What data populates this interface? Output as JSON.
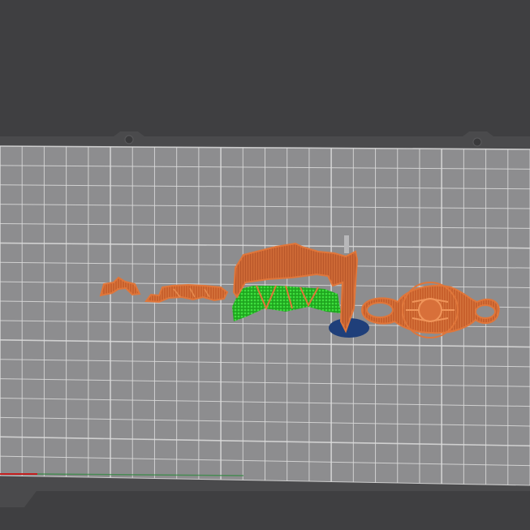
{
  "scene": {
    "background_color": "#3f3f41",
    "bed_color": "#8d8d8f",
    "bed_frame_color": "#4a4a4c",
    "grid_color": "#dcdcdc",
    "grid_line_count_x": 24,
    "grid_line_count_y": 17
  },
  "axes": {
    "x_axis_color": "#c41e1e",
    "y_axis_color": "#2a8a3a"
  },
  "objects": [
    {
      "name": "small-part",
      "perimeter_color": "#e0763a",
      "infill_color": "#c8602c"
    },
    {
      "name": "text-strip-part",
      "perimeter_color": "#e0763a",
      "infill_color": "#c8602c"
    },
    {
      "name": "curved-wall-part",
      "perimeter_color": "#e0763a",
      "infill_color": "#b9572a",
      "support_color": "#2bd02b"
    },
    {
      "name": "wipe-tower",
      "color": "#1f3f7a"
    },
    {
      "name": "ornate-disc-part",
      "perimeter_color": "#e0763a",
      "infill_color": "#c8602c"
    }
  ]
}
